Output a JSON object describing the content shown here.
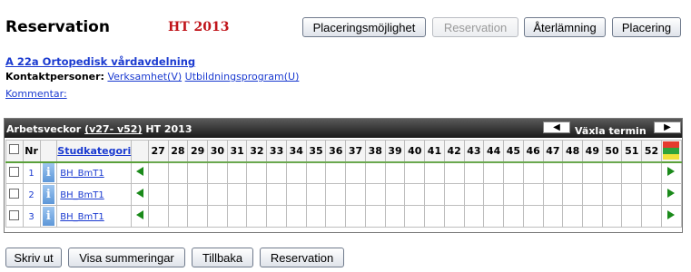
{
  "header": {
    "title": "Reservation",
    "term": "HT 2013",
    "buttons": [
      {
        "label": "Placeringsmöjlighet",
        "enabled": true
      },
      {
        "label": "Reservation",
        "enabled": false
      },
      {
        "label": "Återlämning",
        "enabled": true
      },
      {
        "label": "Placering",
        "enabled": true
      }
    ]
  },
  "unit": {
    "name": "A 22a Ortopedisk vårdavdelning",
    "contact_label": "Kontaktpersoner:",
    "contact_links": [
      "Verksamhet(V)",
      "Utbildningsprogram(U)"
    ],
    "comment_link": "Kommentar:"
  },
  "weeks_panel": {
    "title_prefix": "Arbetsveckor",
    "title_range": "(v27- v52)",
    "title_term": "HT 2013",
    "toggle_label": "Växla termin",
    "columns": {
      "nr": "Nr",
      "category": "Studkategori"
    },
    "weeks": [
      "27",
      "28",
      "29",
      "30",
      "31",
      "32",
      "33",
      "34",
      "35",
      "36",
      "37",
      "38",
      "39",
      "40",
      "41",
      "42",
      "43",
      "44",
      "45",
      "46",
      "47",
      "48",
      "49",
      "50",
      "51",
      "52"
    ],
    "legend_colors": [
      "#e53b2e",
      "#2fa33a",
      "#f2e23a"
    ],
    "rows": [
      {
        "nr": "1",
        "category": "BH_BmT1"
      },
      {
        "nr": "2",
        "category": "BH_BmT1"
      },
      {
        "nr": "3",
        "category": "BH_BmT1"
      }
    ]
  },
  "footer": {
    "buttons": [
      "Skriv ut",
      "Visa summeringar",
      "Tillbaka",
      "Reservation"
    ]
  }
}
